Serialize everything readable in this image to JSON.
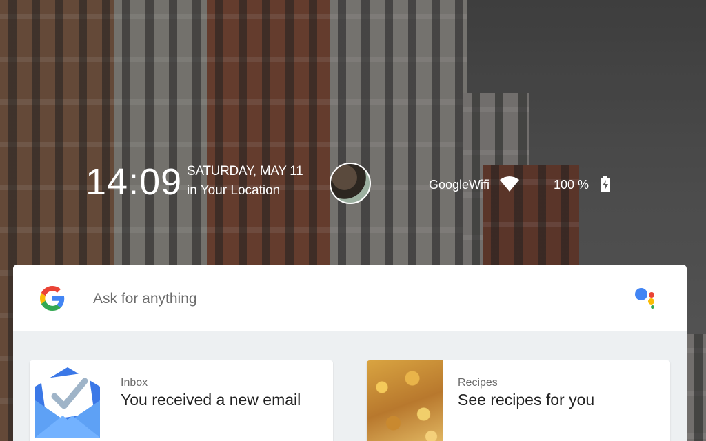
{
  "status": {
    "time": "14:09",
    "date": "SATURDAY, MAY 11",
    "location": "in Your Location",
    "wifi_name": "GoogleWifi",
    "battery": "100 %"
  },
  "icons": {
    "wifi": "wifi-icon",
    "battery": "battery-charging-icon",
    "google": "google-g-logo",
    "assistant": "google-assistant-icon",
    "avatar": "user-avatar"
  },
  "search": {
    "placeholder": "Ask for anything"
  },
  "cards": [
    {
      "source": "Inbox",
      "title": "You received a new email"
    },
    {
      "source": "Recipes",
      "title": "See recipes for you"
    }
  ],
  "colors": {
    "google_blue": "#4285F4",
    "google_red": "#EA4335",
    "google_yellow": "#FBBC05",
    "google_green": "#34A853",
    "inbox_blue": "#4285F4"
  }
}
